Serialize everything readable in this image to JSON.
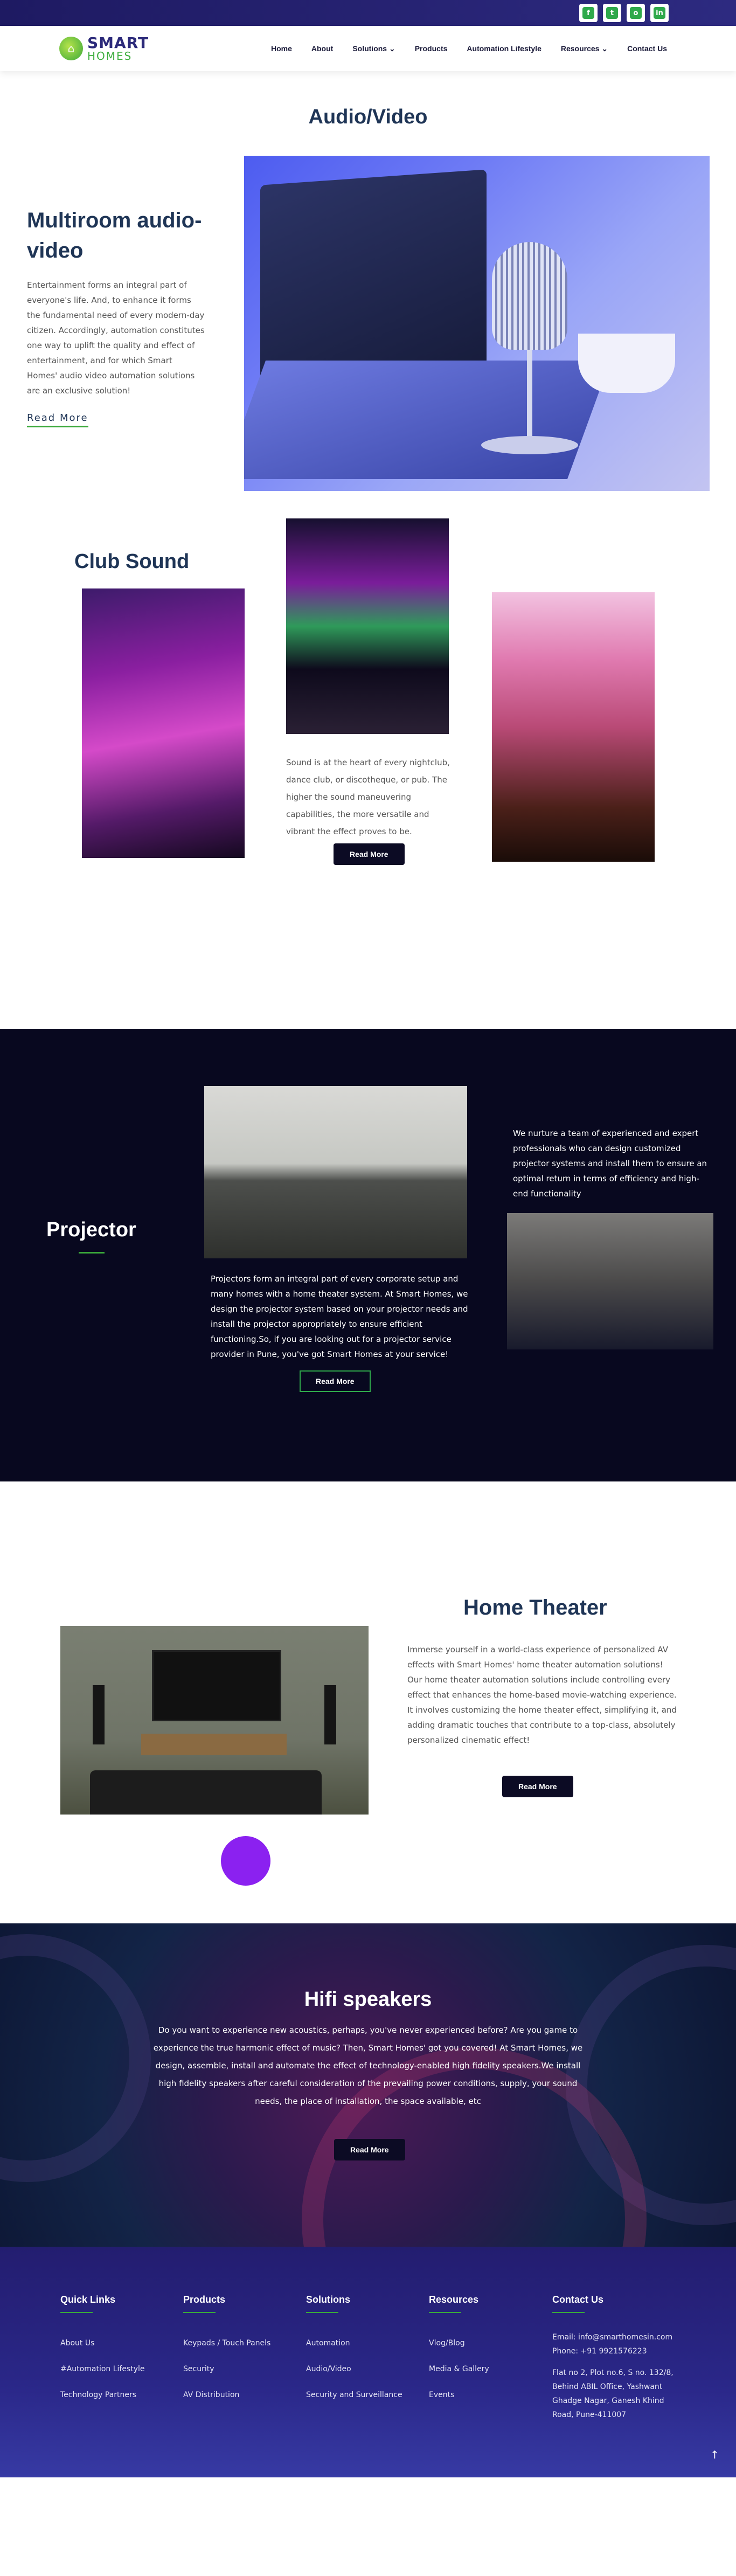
{
  "topbar": {
    "social": [
      "f",
      "t",
      "o",
      "in"
    ]
  },
  "logo": {
    "line1": "SMART",
    "line2": "HOMES"
  },
  "nav": [
    {
      "label": "Home"
    },
    {
      "label": "About"
    },
    {
      "label": "Solutions ⌄"
    },
    {
      "label": "Products"
    },
    {
      "label": "Automation Lifestyle"
    },
    {
      "label": "Resources ⌄"
    },
    {
      "label": "Contact Us"
    }
  ],
  "page_title": "Audio/Video",
  "multiroom": {
    "title": "Multiroom audio-video",
    "desc": "Entertainment forms an integral part of everyone's life. And, to enhance it forms the fundamental need of every modern-day citizen. Accordingly, automation constitutes one way to uplift the quality and effect of entertainment, and for which Smart Homes' audio video automation solutions are an exclusive solution!",
    "link": "Read More"
  },
  "club": {
    "title": "Club Sound",
    "desc": "Sound is at the heart of every nightclub, dance club, or discotheque, or pub. The higher the sound maneuvering capabilities, the more versatile and vibrant the effect proves to be.",
    "button": "Read More"
  },
  "projector": {
    "title": "Projector",
    "desc": "Projectors form an integral part of every corporate setup and many homes with a home theater system. At Smart Homes, we design the projector system based on your projector needs and install the projector appropriately to ensure efficient functioning.So, if you are looking out for a projector service provider in Pune, you've got Smart Homes at your service!",
    "button": "Read More",
    "desc2": "We nurture a team of experienced and expert professionals who can design customized projector systems and install them to ensure an optimal return in terms of efficiency and high-end functionality"
  },
  "theater": {
    "title": "Home Theater",
    "desc": "Immerse yourself in a world-class experience of personalized AV effects with Smart Homes' home theater automation solutions! Our home theater automation solutions include controlling every effect that enhances the home-based movie-watching experience. It involves customizing the home theater effect, simplifying it, and adding dramatic touches that contribute to a top-class, absolutely personalized cinematic effect!",
    "button": "Read More"
  },
  "hifi": {
    "title": "Hifi speakers",
    "desc": "Do you want to experience new acoustics, perhaps, you've never experienced before? Are you game to experience the true harmonic effect of music? Then, Smart Homes' got you covered! At Smart Homes, we design, assemble, install and automate the effect of technology-enabled high fidelity speakers.We install high fidelity speakers after careful consideration of the prevailing power conditions, supply, your sound needs, the place of installation, the space available, etc",
    "button": "Read More"
  },
  "footer": {
    "cols": [
      {
        "head": "Quick Links",
        "links": [
          "About Us",
          "#Automation Lifestyle",
          "Technology Partners"
        ]
      },
      {
        "head": "Products",
        "links": [
          "Keypads / Touch Panels",
          "Security",
          "AV Distribution"
        ]
      },
      {
        "head": "Solutions",
        "links": [
          "Automation",
          "Audio/Video",
          "Security and Surveillance"
        ]
      },
      {
        "head": "Resources",
        "links": [
          "Vlog/Blog",
          "Media & Gallery",
          "Events"
        ]
      }
    ],
    "contact": {
      "head": "Contact Us",
      "email": "Email: info@smarthomesin.com",
      "phone": "Phone: +91 9921576223",
      "address": "Flat no 2, Plot no.6, S no. 132/8, Behind ABIL Office, Yashwant Ghadge Nagar, Ganesh Khind Road, Pune-411007"
    }
  },
  "colors": {
    "brand_dark": "#1f3556",
    "brand_green": "#3aa83a",
    "footer_bg": "#2a2788"
  }
}
